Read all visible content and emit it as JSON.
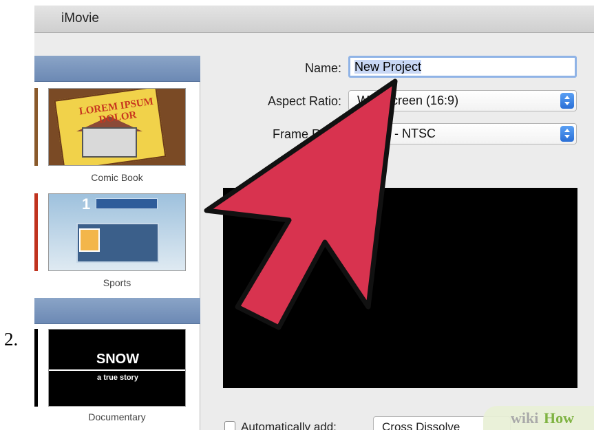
{
  "step": {
    "number": "2."
  },
  "window": {
    "title": "iMovie"
  },
  "themes": [
    {
      "label": "Comic Book",
      "thumb_title": "LOREM IPSUM DOLOR"
    },
    {
      "label": "Sports"
    },
    {
      "label": "Documentary",
      "thumb_title": "SNOW",
      "thumb_subtitle": "a true story"
    }
  ],
  "form": {
    "name_label": "Name:",
    "name_value": "New Project",
    "aspect_label": "Aspect Ratio:",
    "aspect_value": "Widescreen (16:9)",
    "frame_label": "Frame Rate:",
    "frame_value": "30 fps - NTSC",
    "auto_add_label": "Automatically add:",
    "auto_add_value": "Cross Dissolve"
  },
  "watermark": {
    "part1": "wiki",
    "part2": "How"
  },
  "colors": {
    "arrow_fill": "#d8334f",
    "arrow_stroke": "#111111",
    "selection": "#c8d7f5",
    "header_blue": "#7a95bd"
  }
}
